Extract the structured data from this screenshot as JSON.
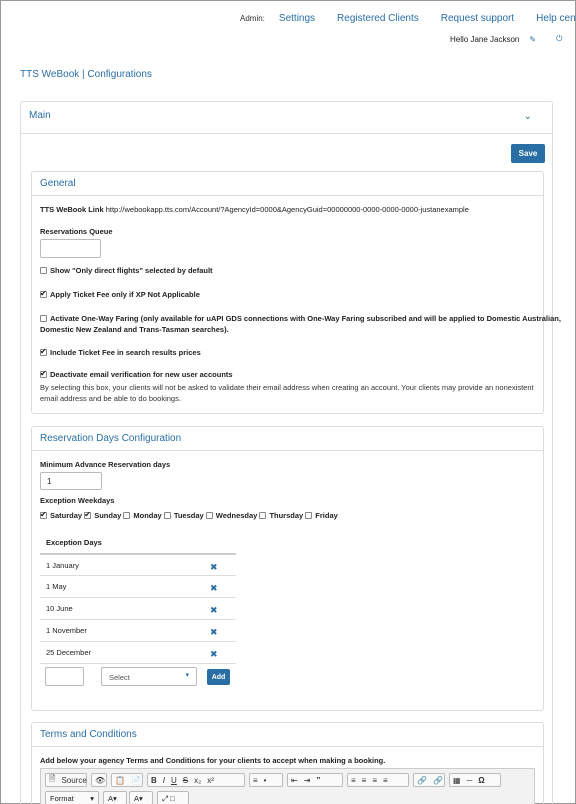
{
  "header": {
    "admin_label": "Admin:",
    "nav": [
      "Settings",
      "Registered Clients",
      "Request support",
      "Help center"
    ],
    "greeting": "Hello Jane Jackson",
    "edit_icon": "✎",
    "power_icon": "⏻"
  },
  "app_title": "TTS WeBook | Configurations",
  "main_panel": {
    "title": "Main",
    "chevron": "⌄",
    "save_label": "Save"
  },
  "general": {
    "title": "General",
    "link_label": "TTS WeBook Link",
    "link_value": "http://webookapp.tts.com/Account/?AgencyId=0000&AgencyGuid=00000000-0000-0000-0000-justanexample",
    "queue_label": "Reservations Queue",
    "queue_value": "",
    "options": [
      {
        "label": "Show \"Only direct flights\" selected by default",
        "checked": false
      },
      {
        "label": "Apply Ticket Fee only if XP Not Applicable",
        "checked": true
      },
      {
        "label": "Activate One-Way Faring (only available for uAPI GDS connections with One-Way Faring subscribed and will be applied to Domestic Australian,",
        "checked": false
      },
      {
        "label": "Include Ticket Fee in search results prices",
        "checked": true
      },
      {
        "label": "Deactivate email verification for new user accounts",
        "checked": true
      }
    ],
    "oneway_cont": "Domestic New Zealand and Trans-Tasman searches).",
    "verify_note_1": "By selecting this box, your clients will not be asked to validate their email address when creating an account. Your clients may provide an nonexistent",
    "verify_note_2": "email address and be able to do bookings."
  },
  "reservation_days": {
    "title": "Reservation Days Configuration",
    "min_label": "Minimum Advance Reservation days",
    "min_value": "1",
    "weekdays_label": "Exception Weekdays",
    "weekdays": [
      {
        "label": "Saturday",
        "checked": true
      },
      {
        "label": "Sunday",
        "checked": true
      },
      {
        "label": "Monday",
        "checked": false
      },
      {
        "label": "Tuesday",
        "checked": false
      },
      {
        "label": "Wednesday",
        "checked": false
      },
      {
        "label": "Thursday",
        "checked": false
      },
      {
        "label": "Friday",
        "checked": false
      }
    ],
    "exception_header": "Exception Days",
    "exception_days": [
      "1 January",
      "1 May",
      "10 June",
      "1 November",
      "25 December"
    ],
    "remove_icon": "✖",
    "day_value": "",
    "month_placeholder": "Select",
    "add_label": "Add"
  },
  "terms": {
    "title": "Terms and Conditions",
    "intro": "Add below your agency Terms and Conditions for your clients to accept when making a booking.",
    "source_label": "Source",
    "format_label": "Format"
  }
}
